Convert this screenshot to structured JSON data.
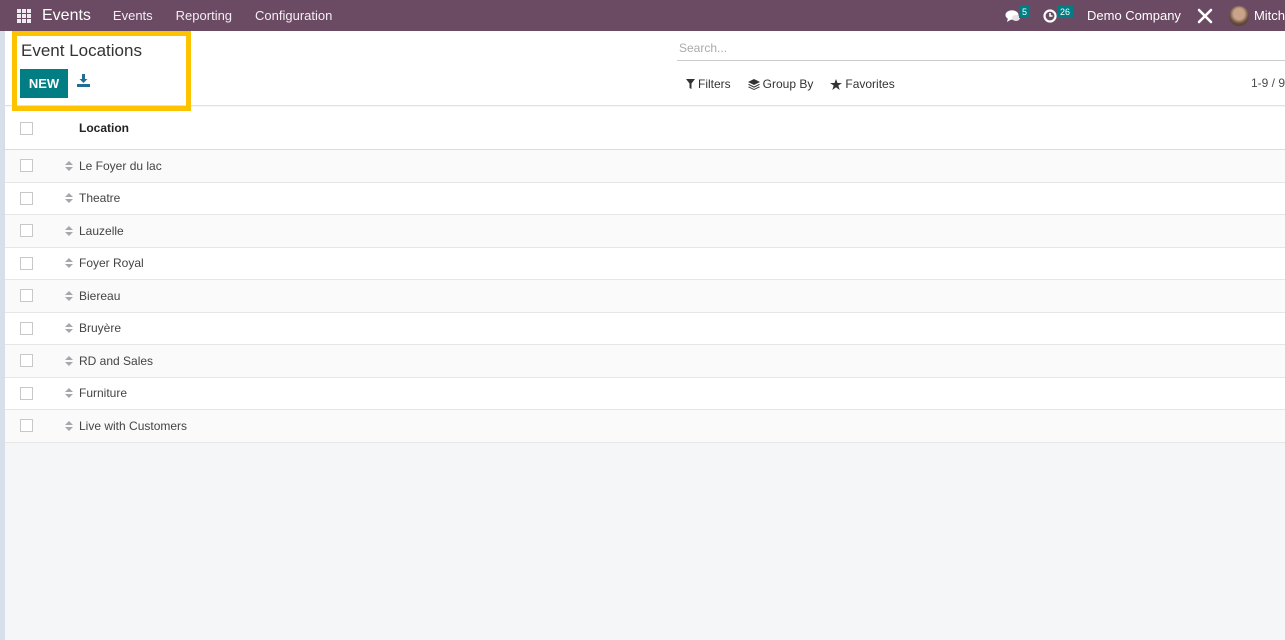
{
  "navbar": {
    "app_name": "Events",
    "menus": [
      "Events",
      "Reporting",
      "Configuration"
    ],
    "messages_count": "5",
    "activities_count": "26",
    "company": "Demo Company",
    "user": "Mitch"
  },
  "control_panel": {
    "title": "Event Locations",
    "new_label": "NEW",
    "search_placeholder": "Search...",
    "filters_label": "Filters",
    "groupby_label": "Group By",
    "favorites_label": "Favorites",
    "pager": "1-9 / 9"
  },
  "table": {
    "column_header": "Location",
    "rows": [
      "Le Foyer du lac",
      "Theatre",
      "Lauzelle",
      "Foyer Royal",
      "Biereau",
      "Bruyère",
      "RD and Sales",
      "Furniture",
      "Live with Customers"
    ]
  },
  "colors": {
    "navbar": "#6b4a64",
    "primary": "#017e84",
    "highlight": "#fdc200"
  }
}
